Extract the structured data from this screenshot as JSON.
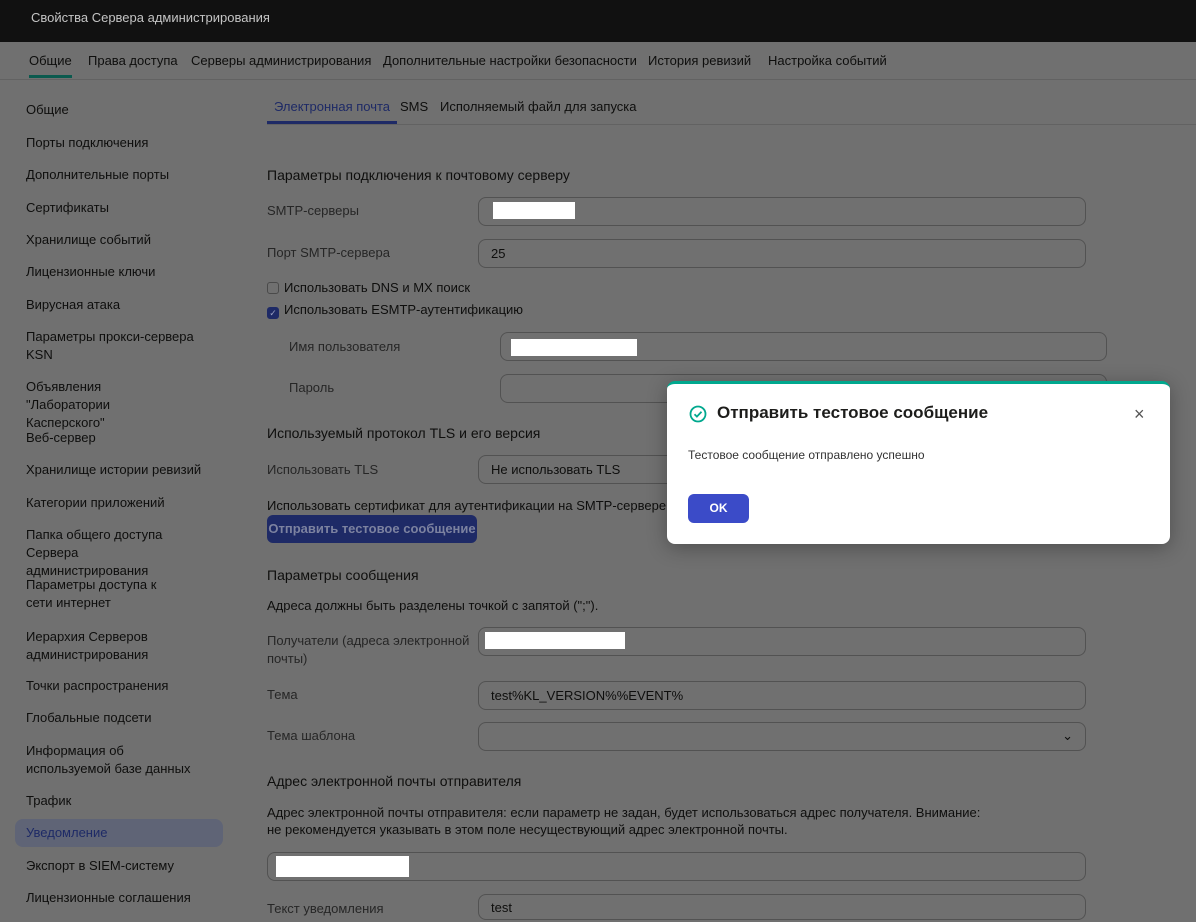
{
  "window": {
    "title": "Свойства Сервера администрирования"
  },
  "top_tabs": [
    "Общие",
    "Права доступа",
    "Серверы администрирования",
    "Дополнительные настройки безопасности",
    "История ревизий",
    "Настройка событий"
  ],
  "nav": [
    "Общие",
    "Порты подключения",
    "Дополнительные порты",
    "Сертификаты",
    "Хранилище событий",
    "Лицензионные ключи",
    "Вирусная атака",
    "Параметры прокси-сервера KSN",
    "Объявления \"Лаборатории Касперского\"",
    "Веб-сервер",
    "Хранилище истории ревизий",
    "Категории приложений",
    "Папка общего доступа Сервера администрирования",
    "Параметры доступа к сети интернет",
    "Иерархия Серверов администрирования",
    "Точки распространения",
    "Глобальные подсети",
    "Информация об используемой базе данных",
    "Трафик",
    "Уведомление",
    "Экспорт в SIEM-систему",
    "Лицензионные соглашения"
  ],
  "sub_tabs": [
    "Электронная почта",
    "SMS",
    "Исполняемый файл для запуска"
  ],
  "form": {
    "conn_heading": "Параметры подключения к почтовому серверу",
    "smtp_servers_label": "SMTP-серверы",
    "smtp_port_label": "Порт SMTP-сервера",
    "smtp_port_value": "25",
    "dns_mx_label": "Использовать DNS и MX поиск",
    "esmtp_label": "Использовать ESMTP-аутентификацию",
    "username_label": "Имя пользователя",
    "password_label": "Пароль",
    "tls_heading": "Используемый протокол TLS и его версия",
    "use_tls_label": "Использовать TLS",
    "use_tls_value": "Не использовать TLS",
    "cert_label": "Использовать сертификат для аутентификации на SMTP-сервере",
    "send_test_button": "Отправить тестовое сообщение",
    "msg_heading": "Параметры сообщения",
    "msg_hint": "Адреса должны быть разделены точкой с запятой (\";\").",
    "recipients_label": "Получатели (адреса электронной почты)",
    "subject_label": "Тема",
    "subject_value": "test%KL_VERSION%%EVENT%",
    "subject_template_label": "Тема шаблона",
    "sender_heading": "Адрес электронной почты отправителя",
    "sender_hint_1": "Адрес электронной почты отправителя: если параметр не задан, будет использоваться адрес получателя. Внимание:",
    "sender_hint_2": "не рекомендуется указывать в этом поле несуществующий адрес электронной почты.",
    "notify_text_label": "Текст уведомления",
    "notify_text_value": "test"
  },
  "dialog": {
    "title": "Отправить тестовое сообщение",
    "message": "Тестовое сообщение отправлено успешно",
    "ok_button": "OK",
    "accent": "#00a88e"
  }
}
